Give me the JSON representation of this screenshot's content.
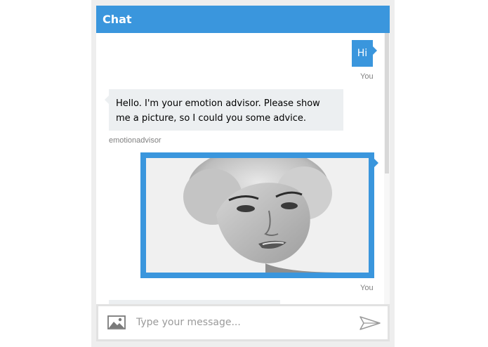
{
  "header": {
    "title": "Chat"
  },
  "messages": [
    {
      "role": "user",
      "text": "Hi",
      "from": "You"
    },
    {
      "role": "bot",
      "text": "Hello. I'm your emotion advisor. Please show me a picture, so I could you some advice.",
      "from": "emotionadvisor"
    },
    {
      "role": "user",
      "attachment": "photo",
      "from": "You"
    },
    {
      "role": "bot",
      "text": ""
    }
  ],
  "input": {
    "placeholder": "Type your message...",
    "value": ""
  },
  "icons": {
    "upload": "image-upload-icon",
    "send": "send-icon"
  },
  "colors": {
    "accent": "#3a96dd",
    "bot_bubble": "#eceff1",
    "sender_text": "#808080"
  }
}
